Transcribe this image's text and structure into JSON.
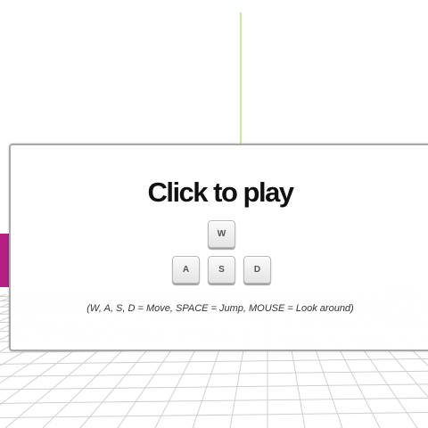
{
  "overlay": {
    "title": "Click to play",
    "keys": {
      "up": "W",
      "left": "A",
      "down": "S",
      "right": "D"
    },
    "instructions": "(W, A, S, D = Move, SPACE = Jump, MOUSE = Look around)"
  },
  "scene": {
    "background_color": "#ffffff",
    "floor_grid_color": "#d0d0d0",
    "vertical_line_color": "#8fd14f",
    "block_color": "#b51e82"
  }
}
